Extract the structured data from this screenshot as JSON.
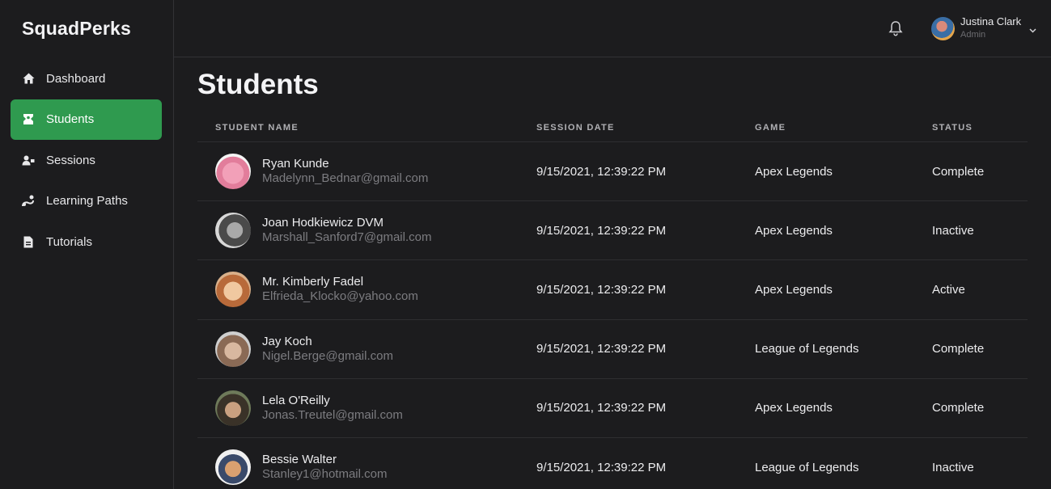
{
  "brand": "SquadPerks",
  "nav": [
    {
      "label": "Dashboard",
      "icon": "home-icon",
      "active": false
    },
    {
      "label": "Students",
      "icon": "student-icon",
      "active": true
    },
    {
      "label": "Sessions",
      "icon": "users-icon",
      "active": false
    },
    {
      "label": "Learning Paths",
      "icon": "path-icon",
      "active": false
    },
    {
      "label": "Tutorials",
      "icon": "document-icon",
      "active": false
    }
  ],
  "user": {
    "name": "Justina Clark",
    "role": "Admin"
  },
  "page": {
    "title": "Students"
  },
  "table": {
    "headers": {
      "name": "STUDENT NAME",
      "date": "SESSION DATE",
      "game": "GAME",
      "status": "STATUS"
    },
    "rows": [
      {
        "name": "Ryan Kunde",
        "email": "Madelynn_Bednar@gmail.com",
        "date": "9/15/2021, 12:39:22 PM",
        "game": "Apex Legends",
        "status": "Complete"
      },
      {
        "name": "Joan Hodkiewicz DVM",
        "email": "Marshall_Sanford7@gmail.com",
        "date": "9/15/2021, 12:39:22 PM",
        "game": "Apex Legends",
        "status": "Inactive"
      },
      {
        "name": "Mr. Kimberly Fadel",
        "email": "Elfrieda_Klocko@yahoo.com",
        "date": "9/15/2021, 12:39:22 PM",
        "game": "Apex Legends",
        "status": "Active"
      },
      {
        "name": "Jay Koch",
        "email": "Nigel.Berge@gmail.com",
        "date": "9/15/2021, 12:39:22 PM",
        "game": "League of Legends",
        "status": "Complete"
      },
      {
        "name": "Lela O'Reilly",
        "email": "Jonas.Treutel@gmail.com",
        "date": "9/15/2021, 12:39:22 PM",
        "game": "Apex Legends",
        "status": "Complete"
      },
      {
        "name": "Bessie Walter",
        "email": "Stanley1@hotmail.com",
        "date": "9/15/2021, 12:39:22 PM",
        "game": "League of Legends",
        "status": "Inactive"
      }
    ]
  },
  "colors": {
    "accent": "#2f9a4f",
    "background": "#1c1c1e",
    "muted_text": "#7c7c80"
  }
}
